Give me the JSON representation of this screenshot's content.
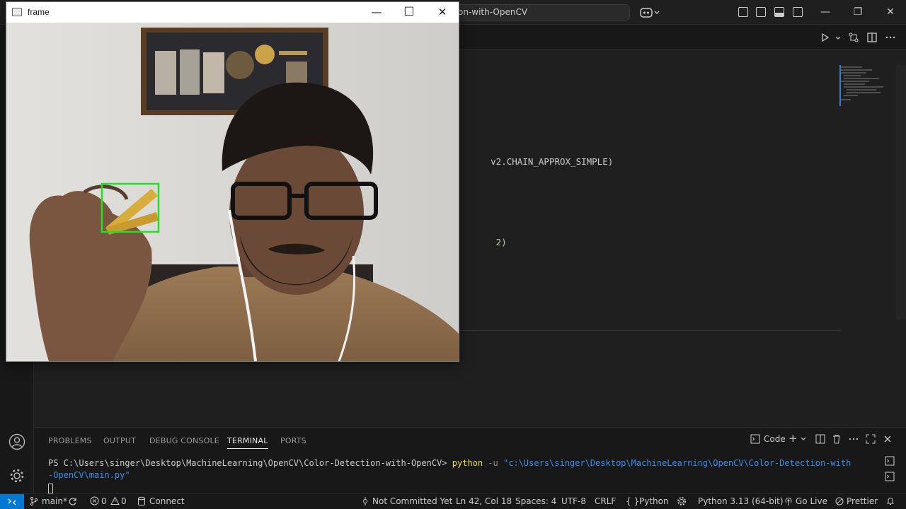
{
  "titlebar": {
    "command_center_text": "on-with-OpenCV",
    "minimize": "—",
    "restore": "❐",
    "close": "✕"
  },
  "editor": {
    "visible_code": [
      {
        "text": "v2.CHAIN_APPROX_SIMPLE)",
        "color": "#9cdcfe"
      },
      {
        "text": " 2)",
        "color": "#b5cea8"
      }
    ]
  },
  "panel": {
    "tabs": [
      "PROBLEMS",
      "OUTPUT",
      "DEBUG CONSOLE",
      "TERMINAL",
      "PORTS"
    ],
    "active_tab": "TERMINAL",
    "terminal_profile": "Code",
    "terminal": {
      "prompt": "PS C:\\Users\\singer\\Desktop\\MachineLearning\\OpenCV\\Color-Detection-with-OpenCV> ",
      "command": "python",
      "arg": " -u ",
      "path_line1": "\"c:\\Users\\singer\\Desktop\\MachineLearning\\OpenCV\\Color-Detection-with",
      "path_line2": "-OpenCV\\main.py\""
    }
  },
  "statusbar": {
    "branch": "main*",
    "errors": "0",
    "warnings": "0",
    "connect": "Connect",
    "blame": "Not Committed Yet",
    "position": "Ln 42, Col 18",
    "spaces": "Spaces: 4",
    "encoding": "UTF-8",
    "eol": "CRLF",
    "language": "Python",
    "interpreter": "Python 3.13 (64-bit)",
    "golive": "Go Live",
    "prettier": "Prettier"
  },
  "cv_window": {
    "title": "frame",
    "minimize": "—",
    "maximize": "☐",
    "close": "✕"
  },
  "colors": {
    "accent": "#0078d4",
    "detection_box": "#22e022"
  }
}
